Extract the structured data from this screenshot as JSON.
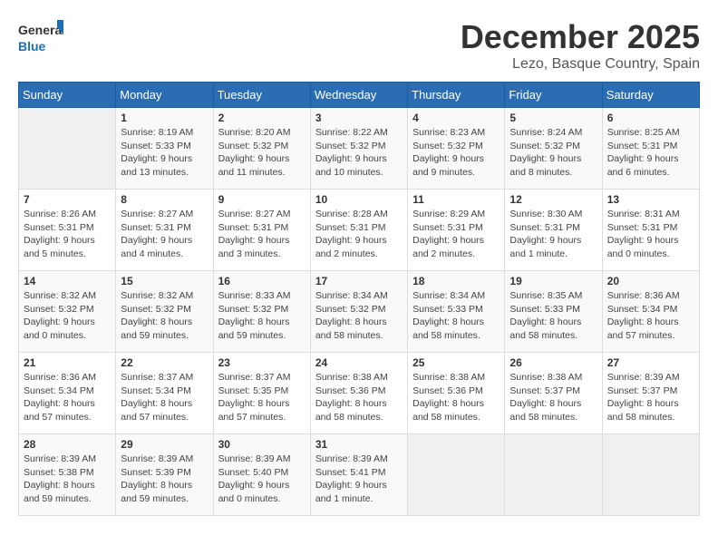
{
  "header": {
    "logo_general": "General",
    "logo_blue": "Blue",
    "month": "December 2025",
    "location": "Lezo, Basque Country, Spain"
  },
  "weekdays": [
    "Sunday",
    "Monday",
    "Tuesday",
    "Wednesday",
    "Thursday",
    "Friday",
    "Saturday"
  ],
  "weeks": [
    [
      {
        "day": "",
        "info": ""
      },
      {
        "day": "1",
        "info": "Sunrise: 8:19 AM\nSunset: 5:33 PM\nDaylight: 9 hours\nand 13 minutes."
      },
      {
        "day": "2",
        "info": "Sunrise: 8:20 AM\nSunset: 5:32 PM\nDaylight: 9 hours\nand 11 minutes."
      },
      {
        "day": "3",
        "info": "Sunrise: 8:22 AM\nSunset: 5:32 PM\nDaylight: 9 hours\nand 10 minutes."
      },
      {
        "day": "4",
        "info": "Sunrise: 8:23 AM\nSunset: 5:32 PM\nDaylight: 9 hours\nand 9 minutes."
      },
      {
        "day": "5",
        "info": "Sunrise: 8:24 AM\nSunset: 5:32 PM\nDaylight: 9 hours\nand 8 minutes."
      },
      {
        "day": "6",
        "info": "Sunrise: 8:25 AM\nSunset: 5:31 PM\nDaylight: 9 hours\nand 6 minutes."
      }
    ],
    [
      {
        "day": "7",
        "info": "Sunrise: 8:26 AM\nSunset: 5:31 PM\nDaylight: 9 hours\nand 5 minutes."
      },
      {
        "day": "8",
        "info": "Sunrise: 8:27 AM\nSunset: 5:31 PM\nDaylight: 9 hours\nand 4 minutes."
      },
      {
        "day": "9",
        "info": "Sunrise: 8:27 AM\nSunset: 5:31 PM\nDaylight: 9 hours\nand 3 minutes."
      },
      {
        "day": "10",
        "info": "Sunrise: 8:28 AM\nSunset: 5:31 PM\nDaylight: 9 hours\nand 2 minutes."
      },
      {
        "day": "11",
        "info": "Sunrise: 8:29 AM\nSunset: 5:31 PM\nDaylight: 9 hours\nand 2 minutes."
      },
      {
        "day": "12",
        "info": "Sunrise: 8:30 AM\nSunset: 5:31 PM\nDaylight: 9 hours\nand 1 minute."
      },
      {
        "day": "13",
        "info": "Sunrise: 8:31 AM\nSunset: 5:31 PM\nDaylight: 9 hours\nand 0 minutes."
      }
    ],
    [
      {
        "day": "14",
        "info": "Sunrise: 8:32 AM\nSunset: 5:32 PM\nDaylight: 9 hours\nand 0 minutes."
      },
      {
        "day": "15",
        "info": "Sunrise: 8:32 AM\nSunset: 5:32 PM\nDaylight: 8 hours\nand 59 minutes."
      },
      {
        "day": "16",
        "info": "Sunrise: 8:33 AM\nSunset: 5:32 PM\nDaylight: 8 hours\nand 59 minutes."
      },
      {
        "day": "17",
        "info": "Sunrise: 8:34 AM\nSunset: 5:32 PM\nDaylight: 8 hours\nand 58 minutes."
      },
      {
        "day": "18",
        "info": "Sunrise: 8:34 AM\nSunset: 5:33 PM\nDaylight: 8 hours\nand 58 minutes."
      },
      {
        "day": "19",
        "info": "Sunrise: 8:35 AM\nSunset: 5:33 PM\nDaylight: 8 hours\nand 58 minutes."
      },
      {
        "day": "20",
        "info": "Sunrise: 8:36 AM\nSunset: 5:34 PM\nDaylight: 8 hours\nand 57 minutes."
      }
    ],
    [
      {
        "day": "21",
        "info": "Sunrise: 8:36 AM\nSunset: 5:34 PM\nDaylight: 8 hours\nand 57 minutes."
      },
      {
        "day": "22",
        "info": "Sunrise: 8:37 AM\nSunset: 5:34 PM\nDaylight: 8 hours\nand 57 minutes."
      },
      {
        "day": "23",
        "info": "Sunrise: 8:37 AM\nSunset: 5:35 PM\nDaylight: 8 hours\nand 57 minutes."
      },
      {
        "day": "24",
        "info": "Sunrise: 8:38 AM\nSunset: 5:36 PM\nDaylight: 8 hours\nand 58 minutes."
      },
      {
        "day": "25",
        "info": "Sunrise: 8:38 AM\nSunset: 5:36 PM\nDaylight: 8 hours\nand 58 minutes."
      },
      {
        "day": "26",
        "info": "Sunrise: 8:38 AM\nSunset: 5:37 PM\nDaylight: 8 hours\nand 58 minutes."
      },
      {
        "day": "27",
        "info": "Sunrise: 8:39 AM\nSunset: 5:37 PM\nDaylight: 8 hours\nand 58 minutes."
      }
    ],
    [
      {
        "day": "28",
        "info": "Sunrise: 8:39 AM\nSunset: 5:38 PM\nDaylight: 8 hours\nand 59 minutes."
      },
      {
        "day": "29",
        "info": "Sunrise: 8:39 AM\nSunset: 5:39 PM\nDaylight: 8 hours\nand 59 minutes."
      },
      {
        "day": "30",
        "info": "Sunrise: 8:39 AM\nSunset: 5:40 PM\nDaylight: 9 hours\nand 0 minutes."
      },
      {
        "day": "31",
        "info": "Sunrise: 8:39 AM\nSunset: 5:41 PM\nDaylight: 9 hours\nand 1 minute."
      },
      {
        "day": "",
        "info": ""
      },
      {
        "day": "",
        "info": ""
      },
      {
        "day": "",
        "info": ""
      }
    ]
  ]
}
